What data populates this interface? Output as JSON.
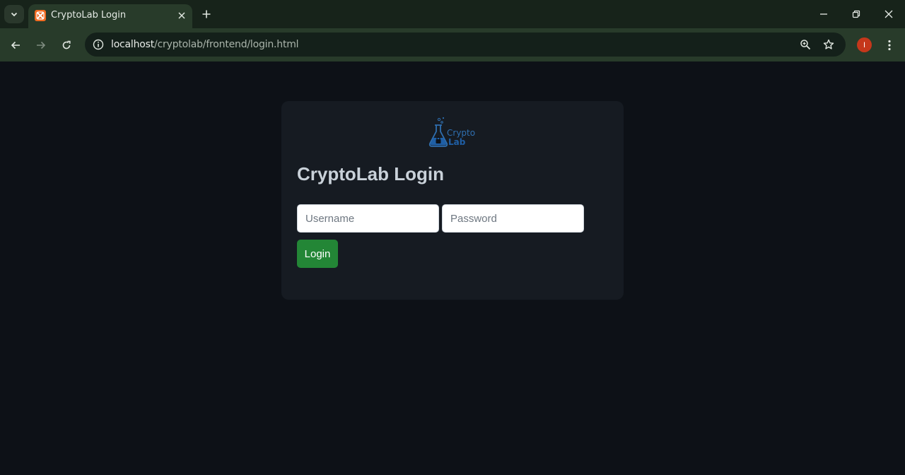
{
  "browser": {
    "tab": {
      "title": "CryptoLab Login",
      "favicon": "xampp-favicon-icon"
    },
    "url": {
      "host": "localhost",
      "path": "/cryptolab/frontend/login.html"
    },
    "profile_initial": "I"
  },
  "login": {
    "logo_line1": "Crypto",
    "logo_line2": "Lab",
    "title": "CryptoLab Login",
    "username_placeholder": "Username",
    "password_placeholder": "Password",
    "submit_label": "Login"
  },
  "colors": {
    "page_bg": "#0d1117",
    "card_bg": "#161b22",
    "button_bg": "#238636",
    "title_text": "#c9d1d9"
  }
}
